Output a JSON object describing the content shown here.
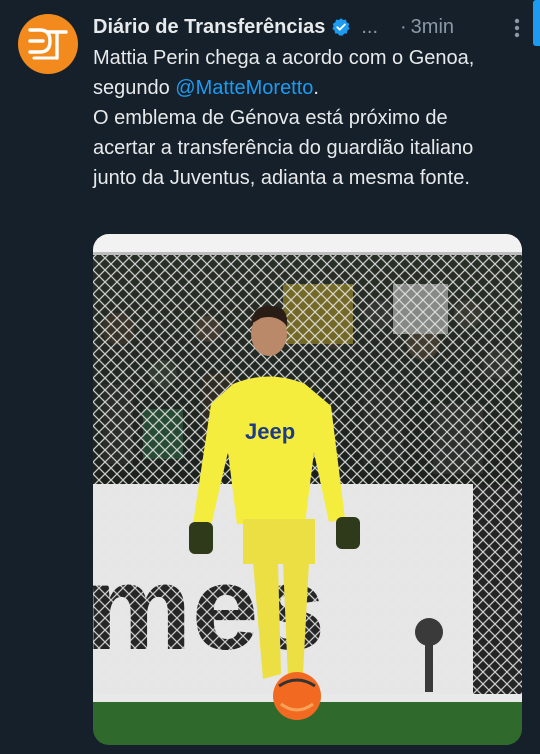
{
  "tweet": {
    "author_name": "Diário de Transferências",
    "handle_ellipsis": "...",
    "separator": "·",
    "timestamp": "3min",
    "text_line1_a": "Mattia Perin chega a acordo com o Genoa, segundo ",
    "mention": "@MatteMoretto",
    "text_line1_b": ".",
    "text_para2": "O emblema de Génova está próximo de acertar a transferência do guardião italiano junto da Juventus, adianta a mesma fonte.",
    "avatar_initials": "DT",
    "brand_color": "#f28a1d",
    "link_color": "#1d9bf0"
  },
  "media": {
    "shirt_sponsor": "Jeep",
    "banner_text": "mes"
  }
}
